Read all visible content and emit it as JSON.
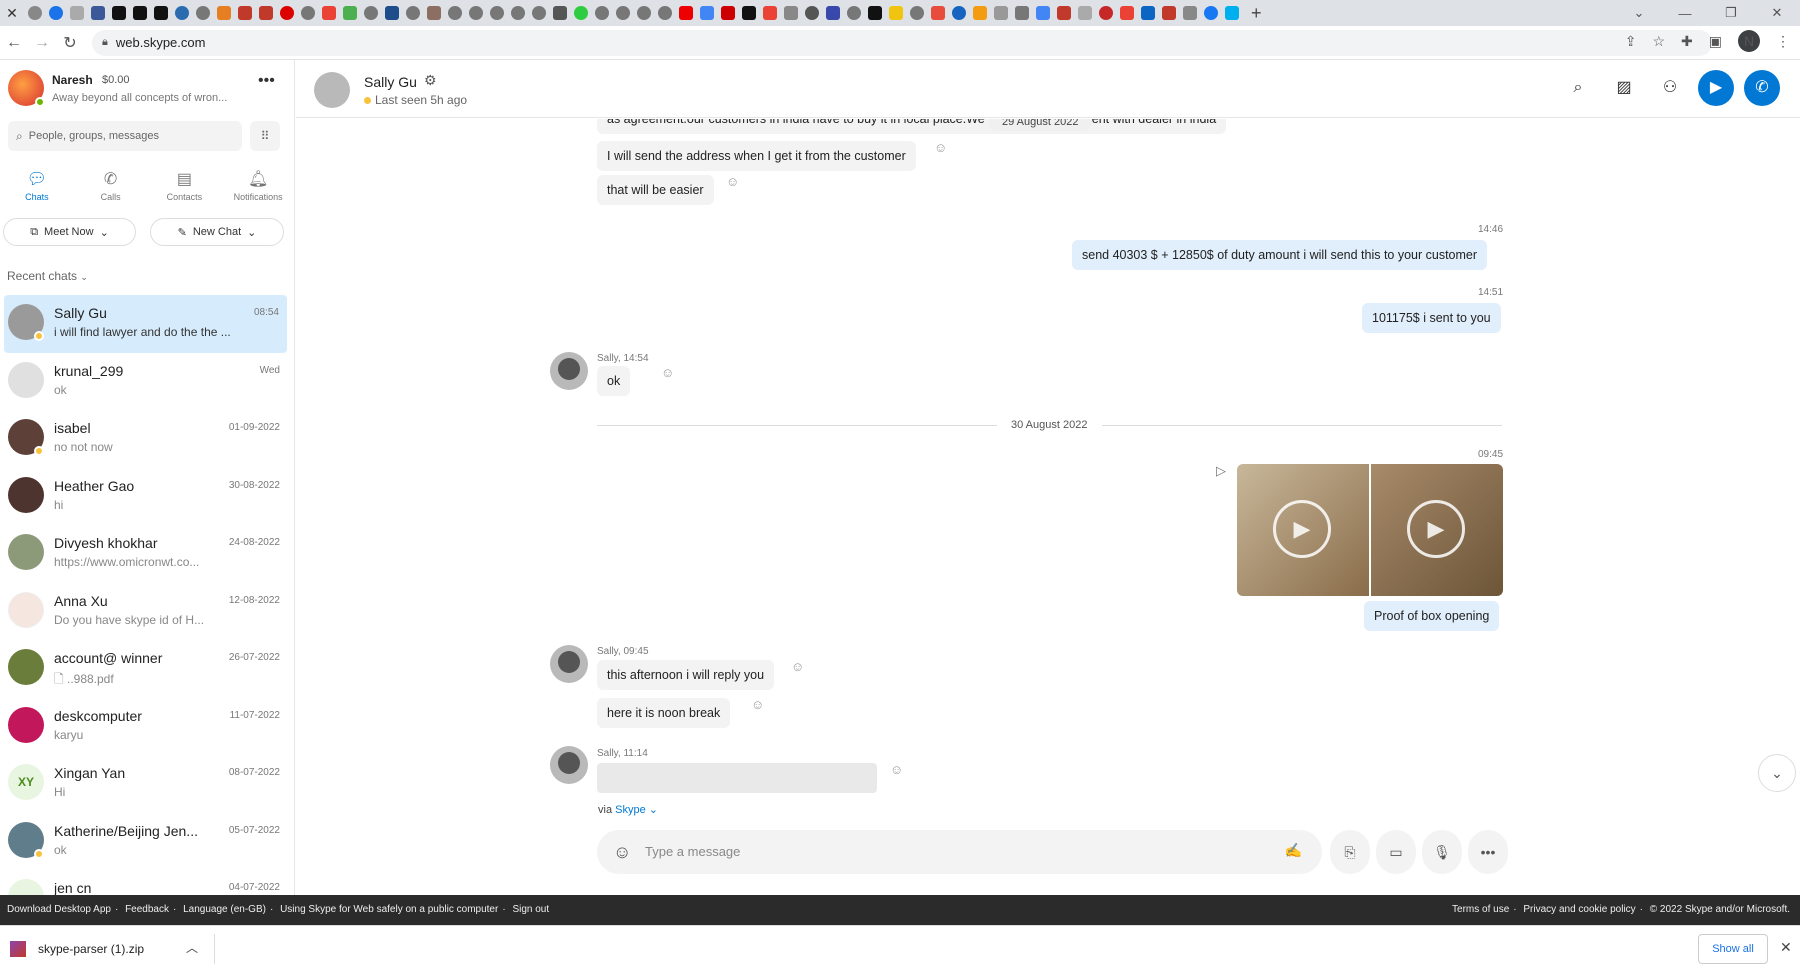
{
  "browser": {
    "url": "web.skype.com",
    "profile_initial": "N"
  },
  "me": {
    "name": "Naresh",
    "balance": "$0.00",
    "status": "Away beyond all concepts of wron..."
  },
  "search": {
    "placeholder": "People, groups, messages"
  },
  "nav": [
    {
      "label": "Chats",
      "icon": "chat-icon"
    },
    {
      "label": "Calls",
      "icon": "phone-icon"
    },
    {
      "label": "Contacts",
      "icon": "contacts-icon"
    },
    {
      "label": "Notifications",
      "icon": "bell-icon"
    }
  ],
  "actions": {
    "meet_now": "Meet Now",
    "new_chat": "New Chat"
  },
  "recent_label": "Recent chats",
  "chats": [
    {
      "name": "Sally Gu",
      "preview": "i will find lawyer and do the the ...",
      "time": "08:54"
    },
    {
      "name": "krunal_299",
      "preview": "ok",
      "time": "Wed"
    },
    {
      "name": "isabel",
      "preview": "no not now",
      "time": "01-09-2022"
    },
    {
      "name": "Heather Gao",
      "preview": "hi",
      "time": "30-08-2022"
    },
    {
      "name": "Divyesh khokhar",
      "preview": "https://www.omicronwt.co...",
      "time": "24-08-2022"
    },
    {
      "name": "Anna Xu",
      "preview": "Do you have skype id of H...",
      "time": "12-08-2022"
    },
    {
      "name": "account@ winner",
      "preview": "..988.pdf",
      "time": "26-07-2022"
    },
    {
      "name": "deskcomputer",
      "preview": "karyu",
      "time": "11-07-2022"
    },
    {
      "name": "Xingan  Yan",
      "preview": "Hi",
      "time": "08-07-2022",
      "initials": "XY"
    },
    {
      "name": "Katherine/Beijing Jen...",
      "preview": "ok",
      "time": "05-07-2022"
    },
    {
      "name": "jen cn",
      "preview": "",
      "time": "04-07-2022"
    }
  ],
  "header": {
    "name": "Sally Gu",
    "seen": "Last seen 5h ago"
  },
  "messages": {
    "m0": "as agreement.our customers in india have to buy it in local place.We signed the agreement with dealer in india",
    "date1": "29 August 2022",
    "m1": "I will send the address when I get it from the customer",
    "m2": "that will be easier",
    "t1": "14:46",
    "m3": "send 40303 $  + 12850$ of duty amount i will send this to your customer",
    "t2": "14:51",
    "m4": "101175$ i sent to you",
    "meta1": "Sally, 14:54",
    "m5": "ok",
    "date2": "30 August 2022",
    "t3": "09:45",
    "m6": "Proof of box opening",
    "meta2": "Sally, 09:45",
    "m7": "this afternoon i will reply you",
    "m8": "here it is noon break",
    "meta3": "Sally, 11:14"
  },
  "via": {
    "prefix": "via",
    "link": "Skype"
  },
  "composer": {
    "placeholder": "Type a message"
  },
  "footer": {
    "left": [
      "Download Desktop App",
      "Feedback",
      "Language (en-GB)",
      "Using Skype for Web safely on a public computer",
      "Sign out"
    ],
    "right": [
      "Terms of use",
      "Privacy and cookie policy",
      "© 2022 Skype and/or Microsoft."
    ]
  },
  "download": {
    "file": "skype-parser (1).zip",
    "show_all": "Show all"
  },
  "colors": {
    "accent": "#0078d4",
    "active_chat": "#d6ebfc",
    "my_bubble": "#e1eefb"
  }
}
